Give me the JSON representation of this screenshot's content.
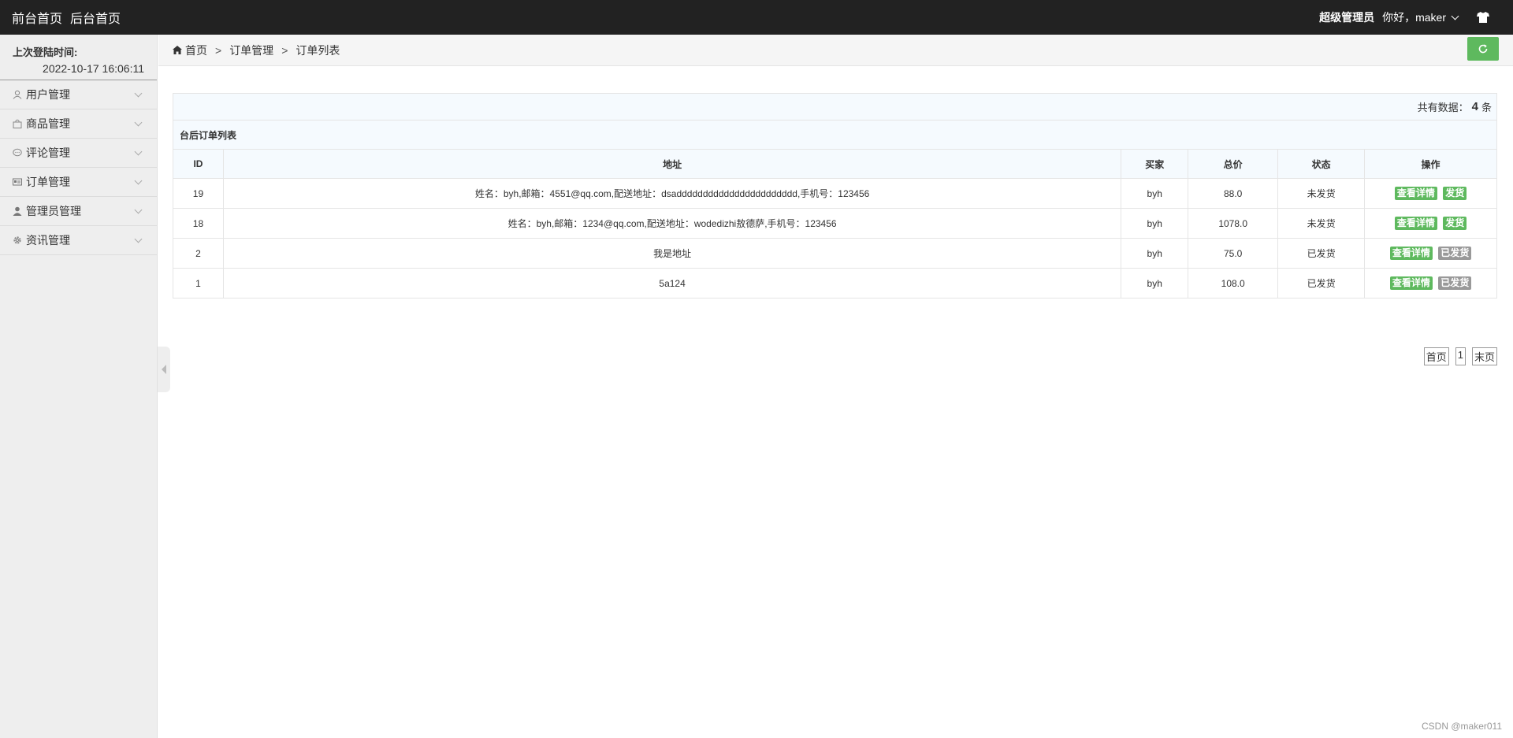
{
  "topbar": {
    "nav_front": "前台首页",
    "nav_back": "后台首页",
    "role": "超级管理员",
    "greeting": "你好，maker"
  },
  "sidebar": {
    "login_label": "上次登陆时间:",
    "login_time": "2022-10-17 16:06:11",
    "items": [
      {
        "label": "用户管理",
        "icon": "user-icon"
      },
      {
        "label": "商品管理",
        "icon": "bag-icon"
      },
      {
        "label": "评论管理",
        "icon": "comment-icon"
      },
      {
        "label": "订单管理",
        "icon": "card-icon"
      },
      {
        "label": "管理员管理",
        "icon": "admin-icon"
      },
      {
        "label": "资讯管理",
        "icon": "gear-icon"
      }
    ]
  },
  "breadcrumb": {
    "home": "首页",
    "sep": ">",
    "level1": "订单管理",
    "level2": "订单列表"
  },
  "summary": {
    "prefix": "共有数据：",
    "count": "4",
    "suffix": "条"
  },
  "table": {
    "title": "台后订单列表",
    "headers": [
      "ID",
      "地址",
      "买家",
      "总价",
      "状态",
      "操作"
    ],
    "rows": [
      {
        "id": "19",
        "address": "姓名：byh,邮箱：4551@qq.com,配送地址：dsaddddddddddddddddddddddd,手机号：123456",
        "buyer": "byh",
        "total": "88.0",
        "status": "未发货",
        "detail": "查看详情",
        "ship": "发货",
        "shipped": false
      },
      {
        "id": "18",
        "address": "姓名：byh,邮箱：1234@qq.com,配送地址：wodedizhi敖德萨,手机号：123456",
        "buyer": "byh",
        "total": "1078.0",
        "status": "未发货",
        "detail": "查看详情",
        "ship": "发货",
        "shipped": false
      },
      {
        "id": "2",
        "address": "我是地址",
        "buyer": "byh",
        "total": "75.0",
        "status": "已发货",
        "detail": "查看详情",
        "ship": "已发货",
        "shipped": true
      },
      {
        "id": "1",
        "address": "5a124",
        "buyer": "byh",
        "total": "108.0",
        "status": "已发货",
        "detail": "查看详情",
        "ship": "已发货",
        "shipped": true
      }
    ]
  },
  "pagination": {
    "first": "首页",
    "page": "1",
    "last": "末页"
  },
  "watermark": "CSDN @maker011",
  "colors": {
    "topbar": "#222222",
    "success": "#5eb95e",
    "disabled": "#999999"
  }
}
